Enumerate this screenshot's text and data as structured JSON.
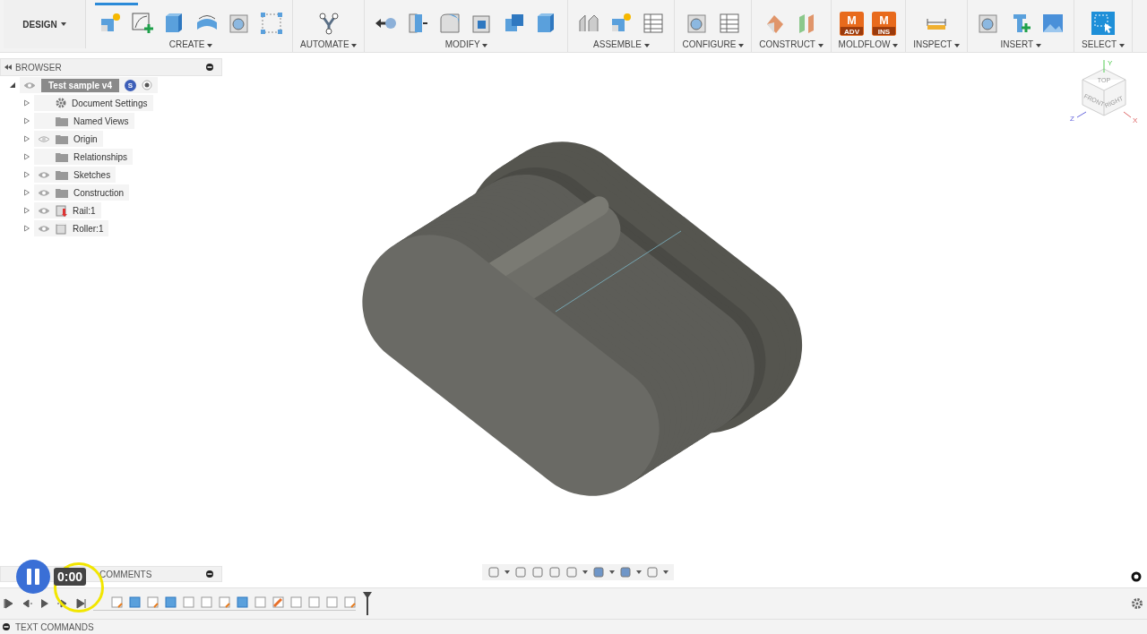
{
  "toolbar": {
    "workspace": "DESIGN",
    "groups": [
      {
        "label": "CREATE",
        "tools": [
          {
            "kind": "cube-star"
          },
          {
            "kind": "sketch"
          },
          {
            "kind": "extrude"
          },
          {
            "kind": "revolve"
          },
          {
            "kind": "hole"
          },
          {
            "kind": "pattern"
          }
        ]
      },
      {
        "label": "AUTOMATE",
        "tools": [
          {
            "kind": "automate"
          }
        ]
      },
      {
        "label": "MODIFY",
        "tools": [
          {
            "kind": "pull"
          },
          {
            "kind": "split"
          },
          {
            "kind": "fillet"
          },
          {
            "kind": "shell"
          },
          {
            "kind": "cube"
          },
          {
            "kind": "extrude"
          }
        ]
      },
      {
        "label": "ASSEMBLE",
        "tools": [
          {
            "kind": "joint"
          },
          {
            "kind": "cube-star"
          },
          {
            "kind": "table"
          }
        ]
      },
      {
        "label": "CONFIGURE",
        "tools": [
          {
            "kind": "hole"
          },
          {
            "kind": "table"
          }
        ]
      },
      {
        "label": "CONSTRUCT",
        "tools": [
          {
            "kind": "plane"
          },
          {
            "kind": "planes"
          }
        ]
      },
      {
        "label": "MOLDFLOW",
        "tools": [
          {
            "kind": "moldflow",
            "letter": "M",
            "tag": "ADV"
          },
          {
            "kind": "moldflow",
            "letter": "M",
            "tag": "INS"
          }
        ]
      },
      {
        "label": "INSPECT",
        "tools": [
          {
            "kind": "ruler"
          }
        ]
      },
      {
        "label": "INSERT",
        "tools": [
          {
            "kind": "hole"
          },
          {
            "kind": "bolt"
          },
          {
            "kind": "image"
          }
        ]
      },
      {
        "label": "SELECT",
        "tools": [
          {
            "kind": "select"
          }
        ]
      }
    ]
  },
  "browser": {
    "title": "BROWSER",
    "root": {
      "label": "Test sample v4",
      "expanded": true,
      "visible": true,
      "badge": "S",
      "children": [
        {
          "label": "Document Settings",
          "kind": "settings"
        },
        {
          "label": "Named Views",
          "kind": "folder"
        },
        {
          "label": "Origin",
          "kind": "folder",
          "visible": false
        },
        {
          "label": "Relationships",
          "kind": "folder"
        },
        {
          "label": "Sketches",
          "kind": "folder",
          "visible": true
        },
        {
          "label": "Construction",
          "kind": "folder",
          "visible": true
        },
        {
          "label": "Rail:1",
          "kind": "component-link",
          "visible": true
        },
        {
          "label": "Roller:1",
          "kind": "component",
          "visible": true
        }
      ]
    }
  },
  "viewcube": {
    "top": "TOP",
    "front": "FRONT",
    "right": "RIGHT",
    "x": "X",
    "y": "Y",
    "z": "Z"
  },
  "comments": {
    "title": "COMMENTS"
  },
  "player": {
    "time": "0:00"
  },
  "text_commands": {
    "title": "TEXT COMMANDS"
  }
}
